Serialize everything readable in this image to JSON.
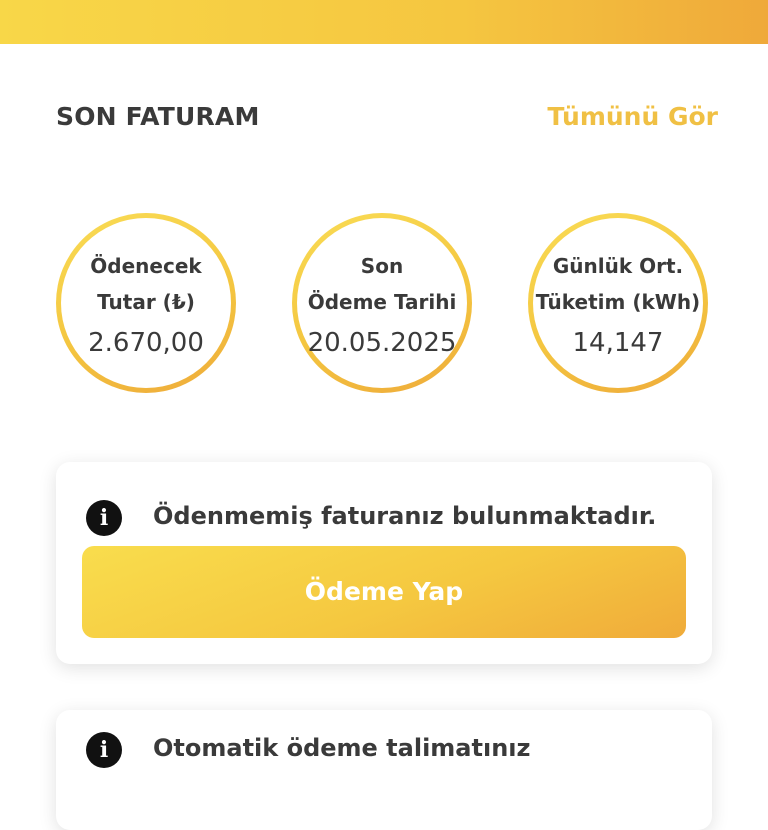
{
  "section": {
    "title": "SON FATURAM",
    "see_all": "Tümünü Gör"
  },
  "stats": [
    {
      "label": "Ödenecek\nTutar (₺)",
      "value": "2.670,00"
    },
    {
      "label": "Son\nÖdeme Tarihi",
      "value": "20.05.2025"
    },
    {
      "label": "Günlük Ort.\nTüketim (kWh)",
      "value": "14,147"
    }
  ],
  "unpaid_card": {
    "message": "Ödenmemiş faturanız bulunmaktadır.",
    "button_label": "Ödeme Yap",
    "icon": "info-icon"
  },
  "autopay_card": {
    "message": "Otomatik ödeme talimatınız",
    "icon": "info-icon"
  },
  "colors": {
    "accent": "#f5c640",
    "accent_dark": "#efa93a",
    "text": "#3a3a3a"
  }
}
